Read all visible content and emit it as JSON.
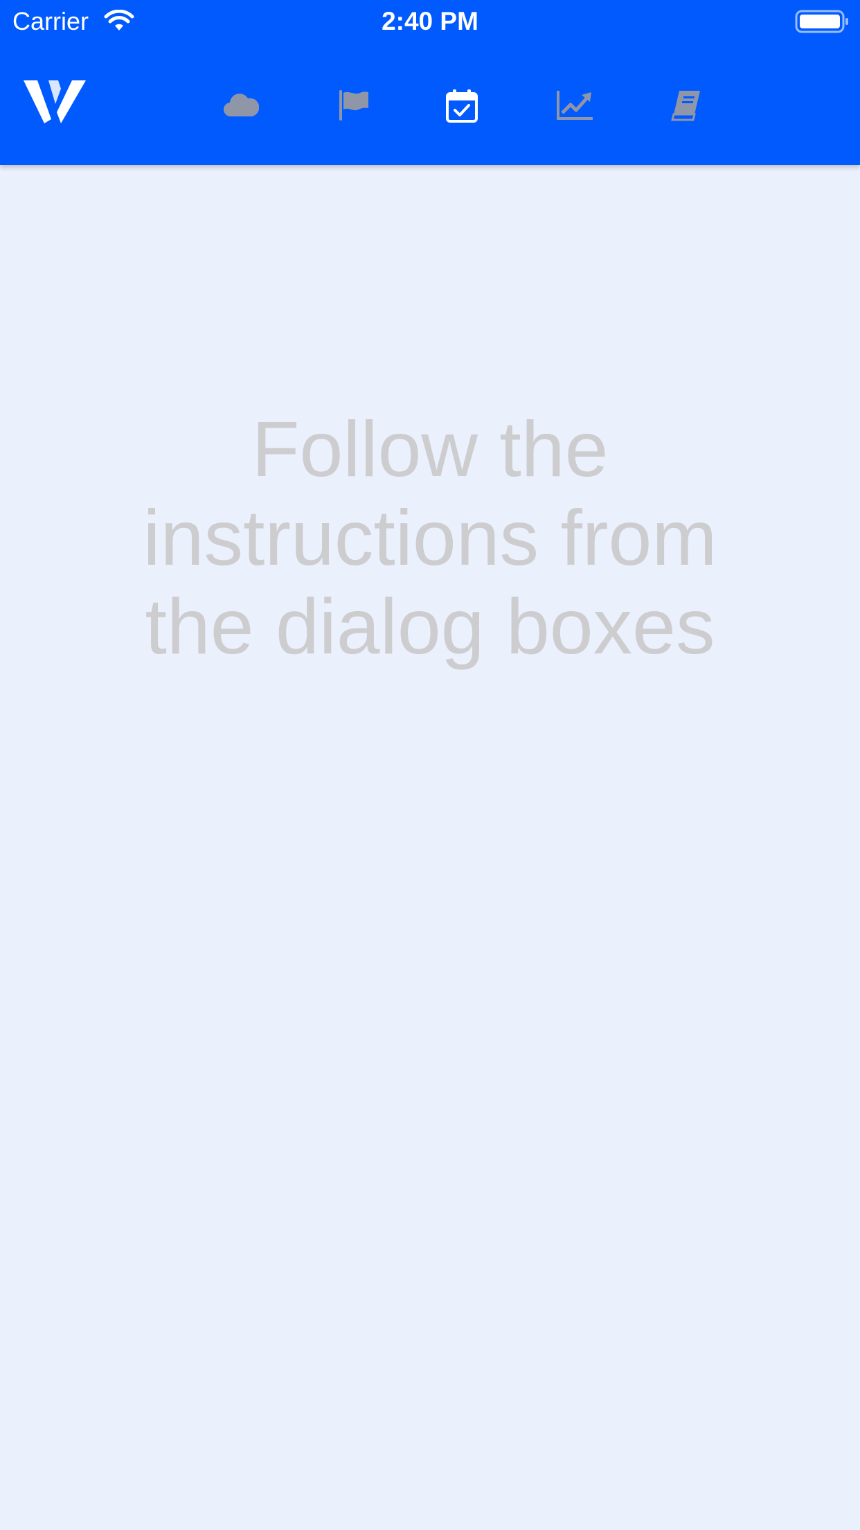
{
  "status_bar": {
    "carrier": "Carrier",
    "time": "2:40 PM",
    "wifi_icon": "wifi-icon",
    "battery_icon": "battery-full-icon"
  },
  "header": {
    "logo_icon": "w-logo-icon",
    "background_color": "#005AFE",
    "nav": [
      {
        "name": "cloud-icon",
        "active": false
      },
      {
        "name": "flag-icon",
        "active": false
      },
      {
        "name": "calendar-check-icon",
        "active": true
      },
      {
        "name": "chart-line-icon",
        "active": false
      },
      {
        "name": "book-icon",
        "active": false
      }
    ],
    "inactive_icon_color": "#8E96A8",
    "active_icon_color": "#FFFFFF"
  },
  "main": {
    "background_color": "#EBF0FD",
    "instructions": "Follow the instructions from the dialog boxes",
    "text_color": "#CDCDCF"
  }
}
